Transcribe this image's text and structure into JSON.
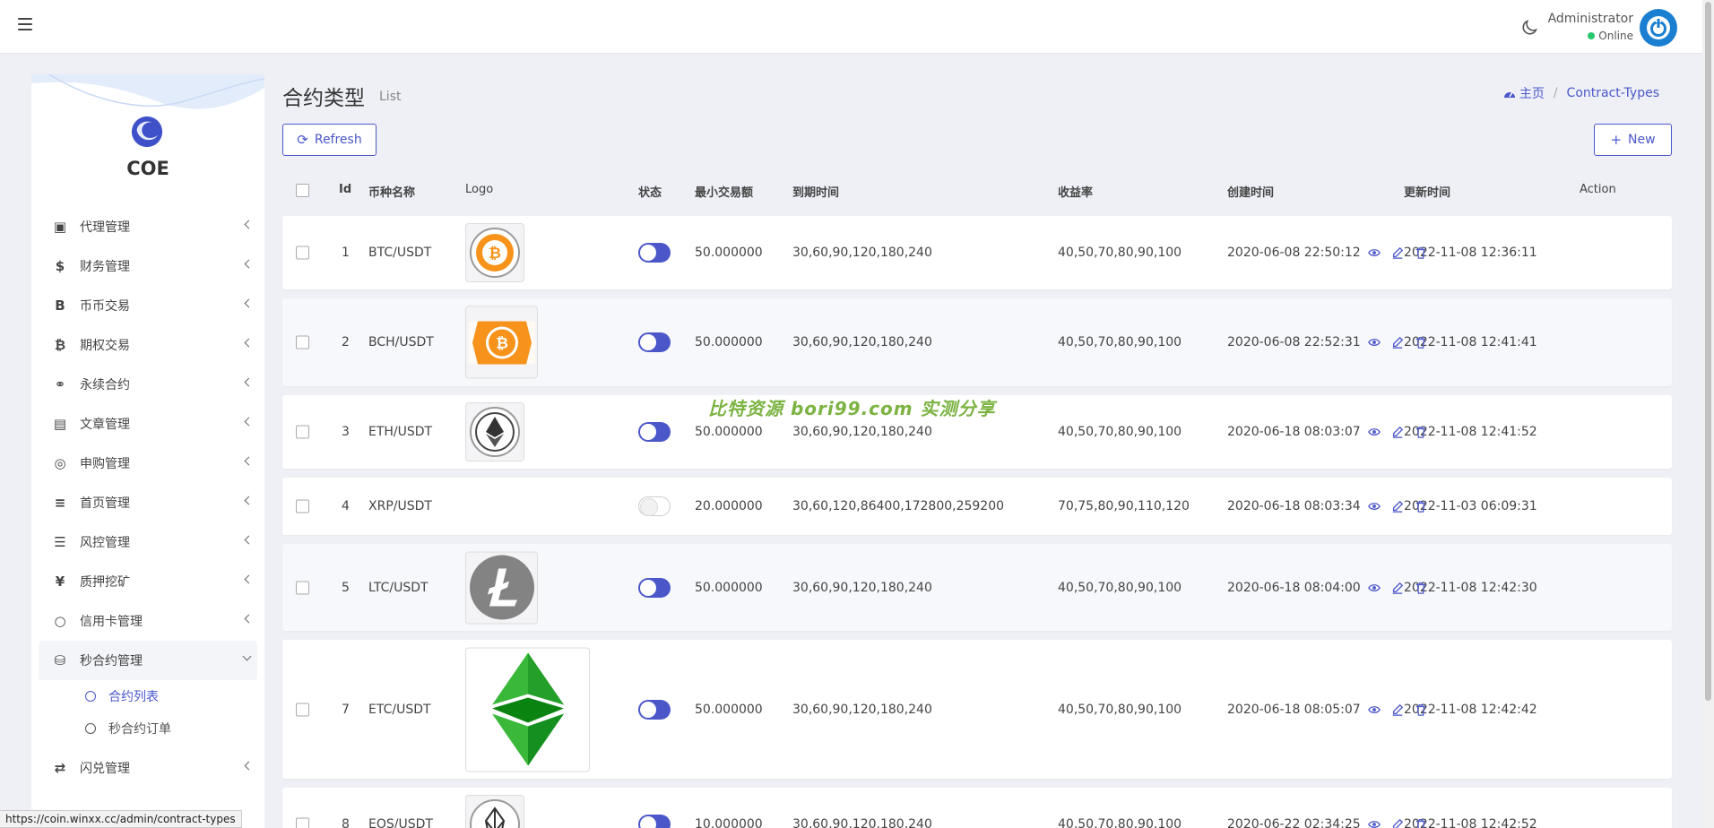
{
  "header": {
    "user_name": "Administrator",
    "user_status": "Online"
  },
  "sidebar": {
    "brand": "COE",
    "items": [
      {
        "label": "代理管理",
        "icon": "id-card-icon"
      },
      {
        "label": "财务管理",
        "icon": "dollar-icon"
      },
      {
        "label": "币币交易",
        "icon": "letter-b-icon"
      },
      {
        "label": "期权交易",
        "icon": "bitcoin-icon"
      },
      {
        "label": "永续合约",
        "icon": "link-icon"
      },
      {
        "label": "文章管理",
        "icon": "newspaper-icon"
      },
      {
        "label": "申购管理",
        "icon": "lifebuoy-icon"
      },
      {
        "label": "首页管理",
        "icon": "list-icon"
      },
      {
        "label": "风控管理",
        "icon": "indent-icon"
      },
      {
        "label": "质押挖矿",
        "icon": "yen-icon"
      },
      {
        "label": "信用卡管理",
        "icon": "circle-icon"
      },
      {
        "label": "秒合约管理",
        "icon": "coins-icon"
      },
      {
        "label": "闪兑管理",
        "icon": "exchange-icon"
      }
    ],
    "subitems": [
      {
        "label": "合约列表",
        "active": true
      },
      {
        "label": "秒合约订单",
        "active": false
      }
    ]
  },
  "page": {
    "title": "合约类型",
    "subtitle": "List",
    "breadcrumb_home": "主页",
    "breadcrumb_current": "Contract-Types",
    "refresh_label": "Refresh",
    "new_label": "New"
  },
  "table": {
    "headers": {
      "id": "Id",
      "name": "币种名称",
      "logo": "Logo",
      "status": "状态",
      "min": "最小交易额",
      "expire": "到期时间",
      "rate": "收益率",
      "created": "创建时间",
      "updated": "更新时间",
      "action": "Action"
    },
    "rows": [
      {
        "id": "1",
        "name": "BTC/USDT",
        "status": true,
        "min": "50.000000",
        "expire": "30,60,90,120,180,240",
        "rate": "40,50,70,80,90,100",
        "created": "2020-06-08 22:50:12",
        "updated": "2022-11-08 12:36:11"
      },
      {
        "id": "2",
        "name": "BCH/USDT",
        "status": true,
        "min": "50.000000",
        "expire": "30,60,90,120,180,240",
        "rate": "40,50,70,80,90,100",
        "created": "2020-06-08 22:52:31",
        "updated": "2022-11-08 12:41:41"
      },
      {
        "id": "3",
        "name": "ETH/USDT",
        "status": true,
        "min": "50.000000",
        "expire": "30,60,90,120,180,240",
        "rate": "40,50,70,80,90,100",
        "created": "2020-06-18 08:03:07",
        "updated": "2022-11-08 12:41:52"
      },
      {
        "id": "4",
        "name": "XRP/USDT",
        "status": false,
        "min": "20.000000",
        "expire": "30,60,120,86400,172800,259200",
        "rate": "70,75,80,90,110,120",
        "created": "2020-06-18 08:03:34",
        "updated": "2022-11-03 06:09:31"
      },
      {
        "id": "5",
        "name": "LTC/USDT",
        "status": true,
        "min": "50.000000",
        "expire": "30,60,90,120,180,240",
        "rate": "40,50,70,80,90,100",
        "created": "2020-06-18 08:04:00",
        "updated": "2022-11-08 12:42:30"
      },
      {
        "id": "7",
        "name": "ETC/USDT",
        "status": true,
        "min": "50.000000",
        "expire": "30,60,90,120,180,240",
        "rate": "40,50,70,80,90,100",
        "created": "2020-06-18 08:05:07",
        "updated": "2022-11-08 12:42:42"
      },
      {
        "id": "8",
        "name": "EOS/USDT",
        "status": true,
        "min": "10.000000",
        "expire": "30,60,90,120,180,240",
        "rate": "40,50,70,80,90,100",
        "created": "2020-06-22 02:34:25",
        "updated": "2022-11-08 12:42:52"
      }
    ]
  },
  "watermark": "比特资源 bori99.com 实测分享",
  "statusbar_url": "https://coin.winxx.cc/admin/contract-types",
  "colors": {
    "accent": "#4b57c9",
    "background": "#eef0f6",
    "online": "#28c76f"
  }
}
